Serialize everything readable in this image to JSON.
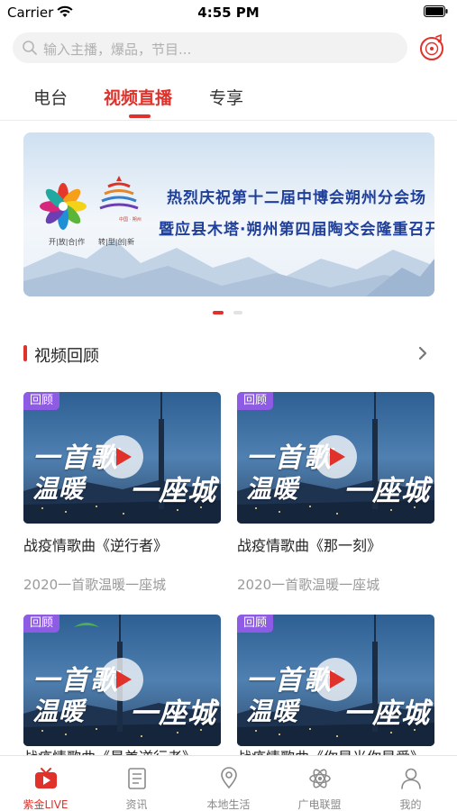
{
  "status_bar": {
    "carrier": "Carrier",
    "time": "4:55 PM"
  },
  "search": {
    "placeholder": "输入主播，爆品，节目..."
  },
  "top_tabs": [
    {
      "label": "电台",
      "active": false
    },
    {
      "label": "视频直播",
      "active": true
    },
    {
      "label": "专享",
      "active": false
    }
  ],
  "banner": {
    "line1": "热烈庆祝第十二届中博会朔州分会场",
    "line2": "暨应县木塔·朔州第四届陶交会隆重召开",
    "logo_left_slogan": "开|放|合|作",
    "logo_right_slogan": "转|型|创|新",
    "logo_right_caption": "中国 · 朔州",
    "pages": 2,
    "current_page": 1
  },
  "section": {
    "title": "视频回顾"
  },
  "cards": [
    {
      "badge": "回顾",
      "thumb_line1": "一首歌",
      "thumb_line2": "温暖",
      "thumb_line3": "一座城",
      "title": "战疫情歌曲《逆行者》",
      "subtitle": "2020一首歌温暖一座城"
    },
    {
      "badge": "回顾",
      "thumb_line1": "一首歌",
      "thumb_line2": "温暖",
      "thumb_line3": "一座城",
      "title": "战疫情歌曲《那一刻》",
      "subtitle": "2020一首歌温暖一座城"
    },
    {
      "badge": "回顾",
      "thumb_line1": "一首歌",
      "thumb_line2": "温暖",
      "thumb_line3": "一座城",
      "title": "战疫情歌曲《最美逆行者》"
    },
    {
      "badge": "回顾",
      "thumb_line1": "一首歌",
      "thumb_line2": "温暖",
      "thumb_line3": "一座城",
      "title": "战疫情歌曲《你是光你是爱》"
    }
  ],
  "bottom_tabs": [
    {
      "label": "紫金LIVE",
      "icon": "tv-icon",
      "active": true
    },
    {
      "label": "资讯",
      "icon": "news-icon",
      "active": false
    },
    {
      "label": "本地生活",
      "icon": "location-icon",
      "active": false
    },
    {
      "label": "广电联盟",
      "icon": "atom-icon",
      "active": false
    },
    {
      "label": "我的",
      "icon": "user-icon",
      "active": false
    }
  ],
  "colors": {
    "accent": "#e0312a",
    "badge": "#8e5be5",
    "banner_text": "#1f3f9a"
  }
}
